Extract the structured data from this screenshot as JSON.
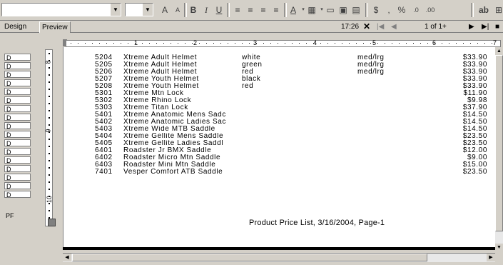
{
  "tabs": [
    "Design",
    "Preview"
  ],
  "nav": {
    "time": "17:26",
    "page_info": "1 of 1+"
  },
  "toolbar": {
    "bold": "B",
    "italic": "I",
    "underline": "U",
    "ab": "ab",
    "currency": "$",
    "percent": "%"
  },
  "gutter": {
    "row_label": "D",
    "footer_label": "PF"
  },
  "ruler": {
    "h_numbers": [
      "1",
      "2",
      "3",
      "4",
      "5",
      "6",
      "7"
    ],
    "v_numbers": [
      "8",
      "9",
      "10"
    ]
  },
  "rows": [
    {
      "id": "5204",
      "name": "Xtreme Adult Helmet",
      "color": "white",
      "size": "med/lrg",
      "price": "$33.90"
    },
    {
      "id": "5205",
      "name": "Xtreme Adult Helmet",
      "color": "green",
      "size": "med/lrg",
      "price": "$33.90"
    },
    {
      "id": "5206",
      "name": "Xtreme Adult Helmet",
      "color": "red",
      "size": "med/lrg",
      "price": "$33.90"
    },
    {
      "id": "5207",
      "name": "Xtreme Youth Helmet",
      "color": "black",
      "size": "",
      "price": "$33.90"
    },
    {
      "id": "5208",
      "name": "Xtreme Youth Helmet",
      "color": "red",
      "size": "",
      "price": "$33.90"
    },
    {
      "id": "5301",
      "name": "Xtreme Mtn Lock",
      "color": "",
      "size": "",
      "price": "$11.90"
    },
    {
      "id": "5302",
      "name": "Xtreme Rhino Lock",
      "color": "",
      "size": "",
      "price": "$9.98"
    },
    {
      "id": "5303",
      "name": "Xtreme Titan Lock",
      "color": "",
      "size": "",
      "price": "$37.90"
    },
    {
      "id": "5401",
      "name": "Xtreme Anatomic Mens Sadc",
      "color": "",
      "size": "",
      "price": "$14.50"
    },
    {
      "id": "5402",
      "name": "Xtreme Anatomic Ladies Sac",
      "color": "",
      "size": "",
      "price": "$14.50"
    },
    {
      "id": "5403",
      "name": "Xtreme Wide MTB Saddle",
      "color": "",
      "size": "",
      "price": "$14.50"
    },
    {
      "id": "5404",
      "name": "Xtreme Gellite Mens Saddle",
      "color": "",
      "size": "",
      "price": "$23.50"
    },
    {
      "id": "5405",
      "name": "Xtreme Gellite Ladies Saddl",
      "color": "",
      "size": "",
      "price": "$23.50"
    },
    {
      "id": "6401",
      "name": "Roadster Jr BMX Saddle",
      "color": "",
      "size": "",
      "price": "$12.00"
    },
    {
      "id": "6402",
      "name": "Roadster Micro Mtn Saddle",
      "color": "",
      "size": "",
      "price": "$9.00"
    },
    {
      "id": "6403",
      "name": "Roadster Mini Mtn Saddle",
      "color": "",
      "size": "",
      "price": "$15.00"
    },
    {
      "id": "7401",
      "name": "Vesper Comfort ATB Saddle",
      "color": "",
      "size": "",
      "price": "$23.50"
    }
  ],
  "footer": "Product Price List, 3/16/2004, Page-1"
}
